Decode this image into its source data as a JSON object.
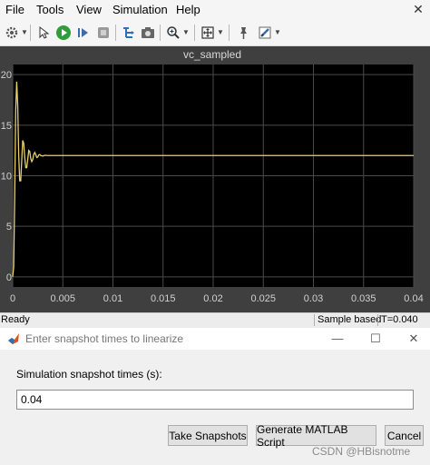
{
  "menu": [
    "File",
    "Tools",
    "View",
    "Simulation",
    "Help"
  ],
  "toolbar": {
    "icons": [
      "gear-icon",
      "help-pointer-icon",
      "run-icon",
      "step-forward-icon",
      "stop-icon",
      "highlight-model-icon",
      "snapshot-icon",
      "zoom-icon",
      "fit-to-view-icon",
      "pin-icon",
      "style-icon"
    ]
  },
  "scope": {
    "title": "vc_sampled",
    "background": "#000000",
    "line_color": "#e8d16a"
  },
  "chart_data": {
    "type": "line",
    "title": "vc_sampled",
    "xlabel": "",
    "ylabel": "",
    "xlim": [
      0,
      0.04
    ],
    "ylim": [
      -1,
      21
    ],
    "x_ticks": [
      "0",
      "0.005",
      "0.01",
      "0.015",
      "0.02",
      "0.025",
      "0.03",
      "0.035",
      "0.04"
    ],
    "x_tick_values": [
      0,
      0.005,
      0.01,
      0.015,
      0.02,
      0.025,
      0.03,
      0.035,
      0.04
    ],
    "y_ticks": [
      "0",
      "5",
      "10",
      "15",
      "20"
    ],
    "y_tick_values": [
      0,
      5,
      10,
      15,
      20
    ],
    "grid": true,
    "series": [
      {
        "x": [
          0,
          0.0001,
          0.0002,
          0.0003,
          0.0004,
          0.0005,
          0.0006,
          0.0007,
          0.0008,
          0.0009,
          0.001,
          0.0011,
          0.0012,
          0.0013,
          0.0014,
          0.0015,
          0.0016,
          0.0017,
          0.0018,
          0.0019,
          0.002,
          0.0021,
          0.0022,
          0.0023,
          0.0024,
          0.0025,
          0.0026,
          0.0027,
          0.0028,
          0.003,
          0.0032,
          0.0035,
          0.004,
          0.0045,
          0.04
        ],
        "y": [
          0,
          1,
          8,
          16.5,
          19.3,
          17,
          12,
          9.5,
          9.5,
          11.5,
          13.5,
          13.2,
          11.8,
          10.8,
          10.8,
          11.6,
          12.5,
          12.4,
          11.7,
          11.4,
          11.6,
          12.1,
          12.3,
          12.1,
          11.8,
          11.85,
          12.05,
          12.1,
          12.0,
          11.95,
          12.02,
          12.0,
          12.0,
          12.0,
          12.0
        ]
      }
    ]
  },
  "statusbar": {
    "ready": "Ready",
    "mode": "Sample based",
    "time": "T=0.040"
  },
  "dialog": {
    "title": "Enter snapshot times to linearize",
    "field_label": "Simulation snapshot times (s):",
    "field_value": "0.04",
    "buttons": {
      "take": "Take Snapshots",
      "generate": "Generate MATLAB Script",
      "cancel": "Cancel"
    }
  },
  "watermark": "CSDN @HBisnotme"
}
